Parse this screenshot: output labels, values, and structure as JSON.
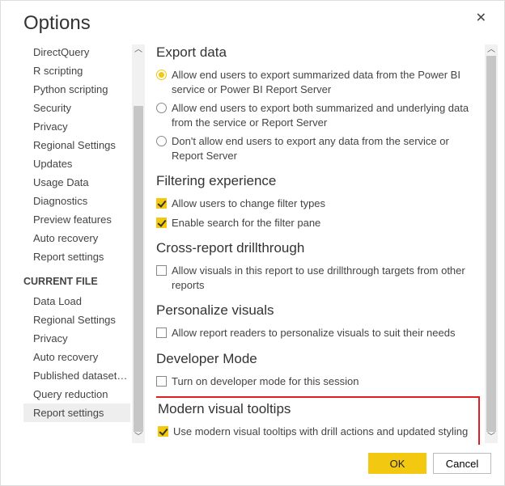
{
  "title": "Options",
  "sidebar": {
    "global_items": [
      "DirectQuery",
      "R scripting",
      "Python scripting",
      "Security",
      "Privacy",
      "Regional Settings",
      "Updates",
      "Usage Data",
      "Diagnostics",
      "Preview features",
      "Auto recovery",
      "Report settings"
    ],
    "current_file_heading": "CURRENT FILE",
    "current_file_items": [
      "Data Load",
      "Regional Settings",
      "Privacy",
      "Auto recovery",
      "Published dataset set...",
      "Query reduction",
      "Report settings"
    ],
    "selected": "Report settings"
  },
  "main": {
    "export_data": {
      "heading": "Export data",
      "opt1": "Allow end users to export summarized data from the Power BI service or Power BI Report Server",
      "opt2": "Allow end users to export both summarized and underlying data from the service or Report Server",
      "opt3": "Don't allow end users to export any data from the service or Report Server",
      "selected": 0
    },
    "filtering": {
      "heading": "Filtering experience",
      "opt1": "Allow users to change filter types",
      "opt2": "Enable search for the filter pane"
    },
    "cross": {
      "heading": "Cross-report drillthrough",
      "opt1": "Allow visuals in this report to use drillthrough targets from other reports"
    },
    "personalize": {
      "heading": "Personalize visuals",
      "opt1": "Allow report readers to personalize visuals to suit their needs"
    },
    "dev": {
      "heading": "Developer Mode",
      "opt1": "Turn on developer mode for this session"
    },
    "tooltips": {
      "heading": "Modern visual tooltips",
      "opt1": "Use modern visual tooltips with drill actions and updated styling"
    }
  },
  "buttons": {
    "ok": "OK",
    "cancel": "Cancel"
  }
}
